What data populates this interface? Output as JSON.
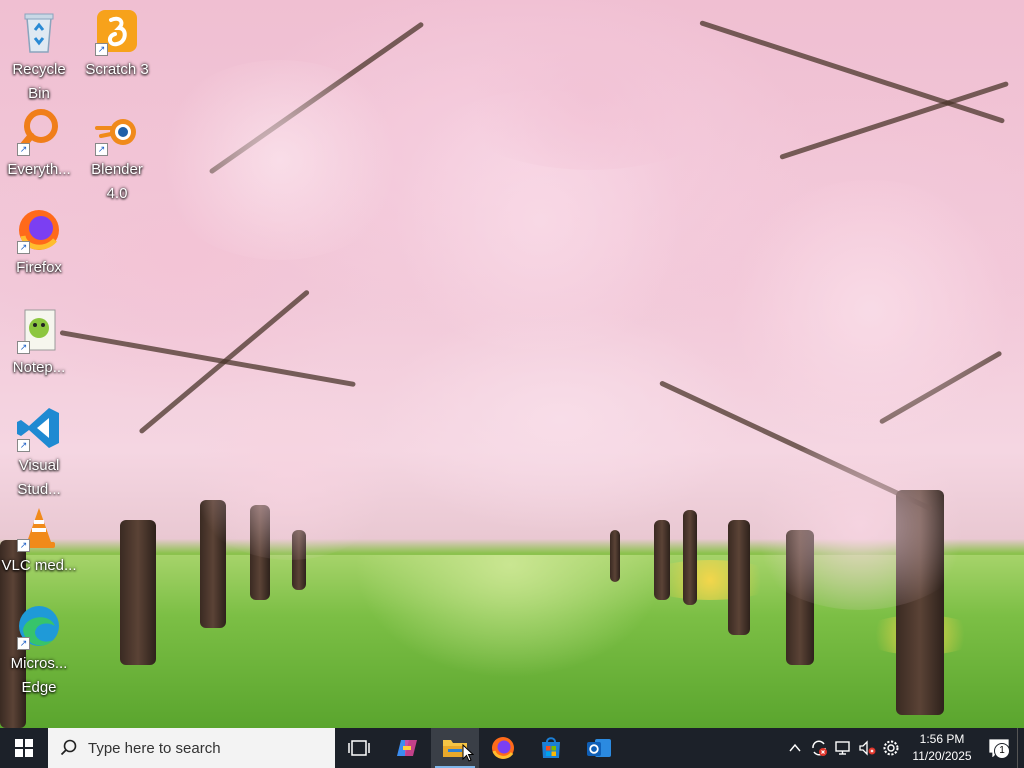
{
  "wallpaper": {
    "name": "cherry-blossom-wallpaper"
  },
  "desktop_icons": [
    {
      "label": "Recycle Bin",
      "icon": "recycle-bin-icon"
    },
    {
      "label": "Scratch 3",
      "icon": "scratch-icon"
    },
    {
      "label": "Everyth...",
      "icon": "everything-search-icon"
    },
    {
      "label": "Blender 4.0",
      "icon": "blender-icon"
    },
    {
      "label": "Firefox",
      "icon": "firefox-icon"
    },
    {
      "label": "Notep...",
      "icon": "notepad-plus-plus-icon"
    },
    {
      "label": "Visual Stud...",
      "icon": "vscode-icon"
    },
    {
      "label": "VLC med...",
      "icon": "vlc-icon"
    },
    {
      "label": "Micros... Edge",
      "icon": "edge-icon"
    }
  ],
  "taskbar": {
    "search_placeholder": "Type here to search",
    "pinned": [
      {
        "name": "task-view",
        "icon": "task-view-icon",
        "active": false
      },
      {
        "name": "copilot",
        "icon": "copilot-icon",
        "active": false
      },
      {
        "name": "file-explorer",
        "icon": "folder-icon",
        "active": true
      },
      {
        "name": "firefox",
        "icon": "firefox-icon",
        "active": false
      },
      {
        "name": "microsoft-store",
        "icon": "store-icon",
        "active": false
      },
      {
        "name": "outlook",
        "icon": "outlook-icon",
        "active": false
      }
    ],
    "tray": {
      "time": "1:56 PM",
      "date": "11/20/2025",
      "notification_count": "1"
    }
  },
  "colors": {
    "taskbar_bg": "#1c2129",
    "active_indicator": "#7fb6ea",
    "accent": "#0078d4"
  }
}
